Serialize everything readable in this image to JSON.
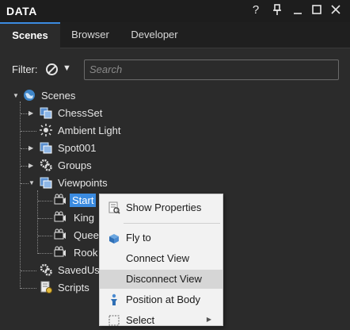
{
  "window": {
    "title": "DATA",
    "controls": {
      "help": "?",
      "pin": "†",
      "minimize": "—",
      "maximize": "□",
      "close": "✕"
    }
  },
  "tabs": [
    {
      "label": "Scenes",
      "active": true
    },
    {
      "label": "Browser",
      "active": false
    },
    {
      "label": "Developer",
      "active": false
    }
  ],
  "filter": {
    "label": "Filter:",
    "dropdown_glyph": "▼",
    "search_placeholder": "Search",
    "search_value": ""
  },
  "tree": {
    "root": {
      "label": "Scenes",
      "icon": "globe-icon"
    },
    "items": [
      {
        "label": "ChessSet",
        "icon": "scene-node-icon",
        "expanded": false
      },
      {
        "label": "Ambient Light",
        "icon": "light-icon",
        "expanded": false
      },
      {
        "label": "Spot001",
        "icon": "spotlight-icon",
        "expanded": false
      },
      {
        "label": "Groups",
        "icon": "gears-icon",
        "expanded": false
      },
      {
        "label": "Viewpoints",
        "icon": "viewpoints-icon",
        "expanded": true,
        "children": [
          {
            "label": "Start",
            "icon": "camera-icon",
            "selected": true
          },
          {
            "label": "King",
            "icon": "camera-icon"
          },
          {
            "label": "Queen",
            "icon": "camera-icon"
          },
          {
            "label": "Rook",
            "icon": "camera-icon"
          }
        ]
      },
      {
        "label": "SavedUse",
        "icon": "gears-icon"
      },
      {
        "label": "Scripts",
        "icon": "script-icon"
      }
    ]
  },
  "context_menu": {
    "items": [
      {
        "label": "Show Properties",
        "icon": "properties-icon"
      },
      {
        "label": "Fly to",
        "icon": "fly-to-icon"
      },
      {
        "label": "Connect View"
      },
      {
        "label": "Disconnect View",
        "highlighted": true
      },
      {
        "label": "Position at Body",
        "icon": "position-body-icon"
      },
      {
        "label": "Select",
        "icon": "select-icon",
        "submenu": "▶"
      }
    ]
  },
  "colors": {
    "selection": "#3b8be0",
    "panel_bg": "#2b2b2b",
    "title_bg": "#1d1d1d",
    "menu_bg": "#f2f2f2",
    "menu_highlight": "#d6d6d6"
  }
}
